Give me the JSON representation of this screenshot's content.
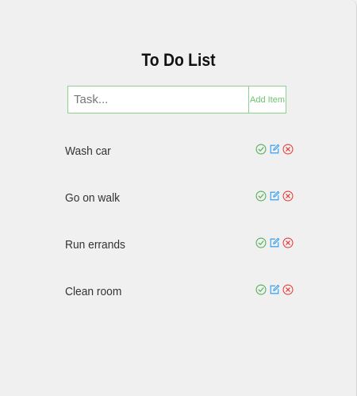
{
  "app": {
    "title": "To Do List"
  },
  "form": {
    "placeholder": "Task...",
    "value": "",
    "add_label": "Add Item"
  },
  "items": [
    {
      "label": "Wash car"
    },
    {
      "label": "Go on walk"
    },
    {
      "label": "Run errands"
    },
    {
      "label": "Clean room"
    }
  ],
  "icons": {
    "complete": "check-circle-icon",
    "edit": "edit-icon",
    "delete": "x-circle-icon"
  },
  "colors": {
    "complete": "#4caf50",
    "edit": "#2196f3",
    "delete": "#e53935",
    "form_border": "#8ed08e",
    "add_text": "#6cc36c"
  }
}
